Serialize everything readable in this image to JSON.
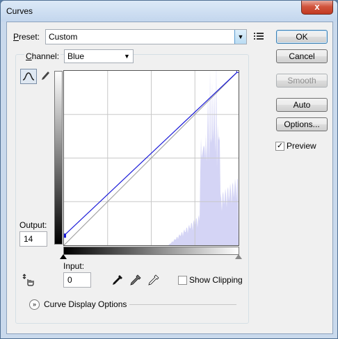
{
  "window": {
    "title": "Curves",
    "close_glyph": "x"
  },
  "preset": {
    "label_prefix": "P",
    "label_rest": "reset:",
    "value": "Custom",
    "menu_icon": "preset-options-icon"
  },
  "channel": {
    "label_prefix": "C",
    "label_rest": "hannel:",
    "value": "Blue"
  },
  "buttons": {
    "ok": "OK",
    "cancel": "Cancel",
    "smooth": "Smooth",
    "auto": "Auto",
    "options": "Options..."
  },
  "preview": {
    "label": "Preview",
    "checked": true
  },
  "output": {
    "label": "Output:",
    "value": "14"
  },
  "input": {
    "label": "Input:",
    "value": "0"
  },
  "show_clipping": {
    "label": "Show Clipping",
    "checked": false
  },
  "curve_display": {
    "label": "Curve Display Options"
  },
  "tools": {
    "curve_tool": "curve-point-icon",
    "pencil_tool": "pencil-icon",
    "on_image_adjust": "on-image-adjust-icon",
    "eyedroppers": [
      "black-point-eyedropper-icon",
      "gray-point-eyedropper-icon",
      "white-point-eyedropper-icon"
    ]
  },
  "curve": {
    "channel_color": "#1a1ad8",
    "points": [
      [
        0,
        14
      ],
      [
        255,
        255
      ]
    ]
  }
}
